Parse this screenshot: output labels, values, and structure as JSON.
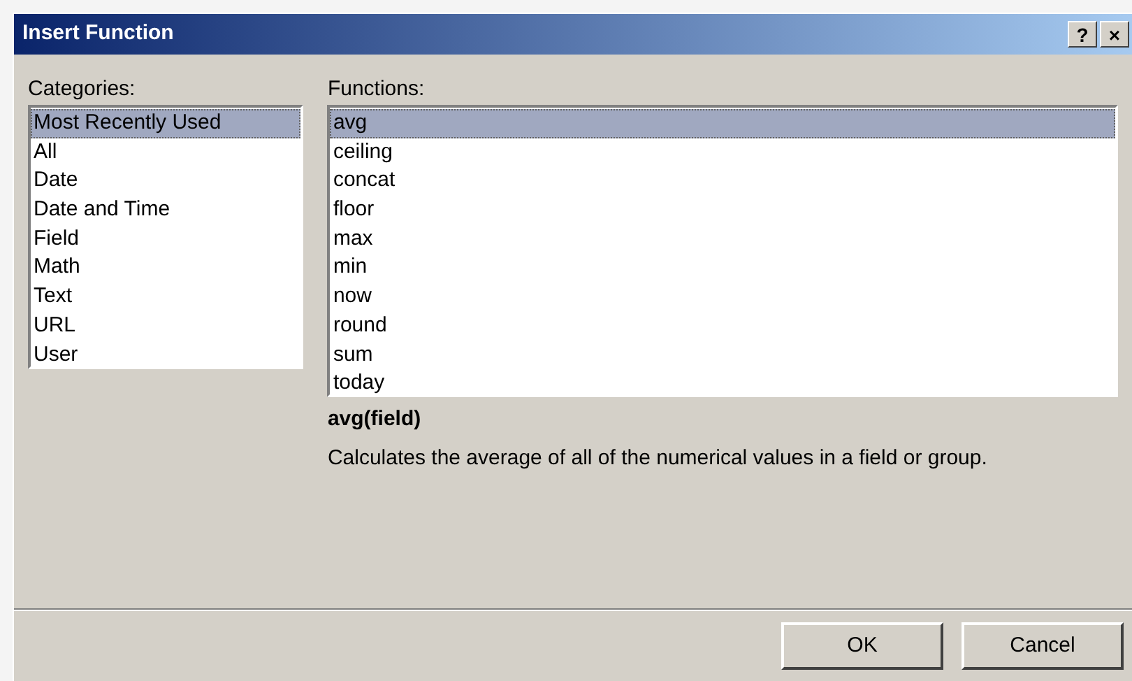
{
  "window": {
    "title": "Insert Function",
    "title_buttons": [
      "?",
      "×"
    ]
  },
  "categories": {
    "label": "Categories:",
    "items": [
      {
        "label": "Most Recently Used",
        "selected": true
      },
      {
        "label": "All",
        "selected": false
      },
      {
        "label": "Date",
        "selected": false
      },
      {
        "label": "Date and Time",
        "selected": false
      },
      {
        "label": "Field",
        "selected": false
      },
      {
        "label": "Math",
        "selected": false
      },
      {
        "label": "Text",
        "selected": false
      },
      {
        "label": "URL",
        "selected": false
      },
      {
        "label": "User",
        "selected": false
      }
    ]
  },
  "functions": {
    "label": "Functions:",
    "items": [
      {
        "label": "avg",
        "selected": true
      },
      {
        "label": "ceiling",
        "selected": false
      },
      {
        "label": "concat",
        "selected": false
      },
      {
        "label": "floor",
        "selected": false
      },
      {
        "label": "max",
        "selected": false
      },
      {
        "label": "min",
        "selected": false
      },
      {
        "label": "now",
        "selected": false
      },
      {
        "label": "round",
        "selected": false
      },
      {
        "label": "sum",
        "selected": false
      },
      {
        "label": "today",
        "selected": false
      }
    ]
  },
  "signature": "avg(field)",
  "description": "Calculates the average of all of the numerical values in a field or group.",
  "buttons": [
    "OK",
    "Cancel"
  ]
}
